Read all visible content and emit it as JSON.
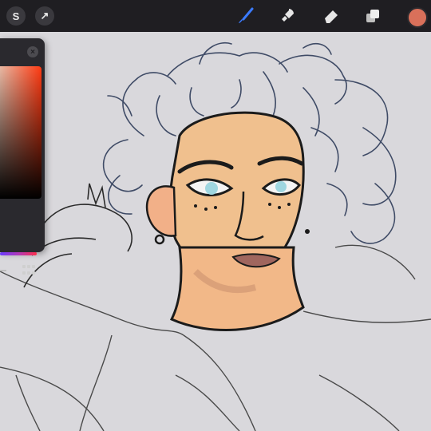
{
  "toolbar": {
    "gallery_glyph": "S",
    "modify_glyph": "↗",
    "tools": [
      "brush-icon",
      "smudge-icon",
      "eraser-icon",
      "layers-icon"
    ],
    "active_tool": "brush-icon",
    "active_color": "#d9705a"
  },
  "color_panel": {
    "close_glyph": "×",
    "hue_gradient": [
      "#6b3cff",
      "#ff2e4a"
    ],
    "saturation_gradient": [
      "#e9b9a4",
      "#ff3a12"
    ]
  },
  "canvas": {
    "background": "#d9d8dc",
    "skin_color": "#f0c08e",
    "line_color": "#1b1b1b"
  }
}
